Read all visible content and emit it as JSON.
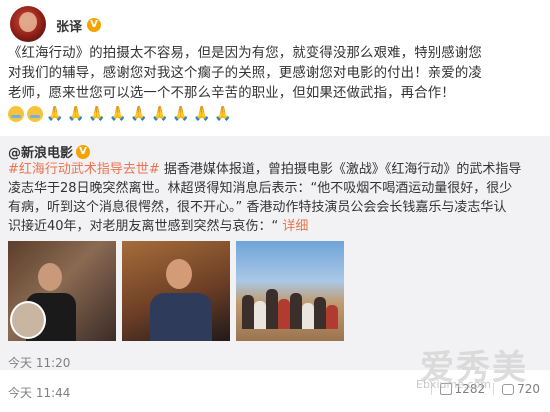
{
  "post": {
    "username": "张译",
    "verified_badge": "V",
    "text_lines": [
      "《红海行动》的拍摄太不容易，但是因为有您，就变得没那么艰难，特别感谢您",
      "对我们的辅导，感谢您对我这个瘸子的关照，更感谢您对电影的付出！亲爱的凌",
      "老师，愿来世您可以选一个不那么辛苦的职业，但如果还做武指，再合作！"
    ],
    "emojis": [
      "sad-cry-emoji",
      "sad-cry-emoji",
      "pray-emoji",
      "pray-emoji",
      "pray-emoji",
      "pray-emoji",
      "pray-emoji",
      "pray-emoji",
      "pray-emoji",
      "pray-emoji",
      "pray-emoji"
    ],
    "time": "今天 11:44",
    "reposts": "1282",
    "comments": "720"
  },
  "repost": {
    "source": "@新浪电影",
    "verified_badge": "V",
    "tag": "#红海行动武术指导去世#",
    "line1_rest": " 据香港媒体报道，曾拍摄电影《激战》《红海行动》的武术指导",
    "line2": "凌志华于28日晚突然离世。林超贤得知消息后表示：“他不吸烟不喝酒运动量很好，很少",
    "line3": "有病，听到这个消息很愕然，很不开心。” 香港动作特技演员公会会长钱嘉乐与凌志华认",
    "line4_text": "识接近40年，对老朋友离世感到突然与哀伤：“",
    "line4_link": "详细",
    "time": "今天 11:20"
  },
  "watermark": {
    "text": "爱秀美",
    "url": "Ebxiume.com"
  },
  "colors": {
    "accent": "#eb7350",
    "verified": "#f4a300",
    "repost_bg": "#f2f2f5",
    "meta": "#808080"
  }
}
